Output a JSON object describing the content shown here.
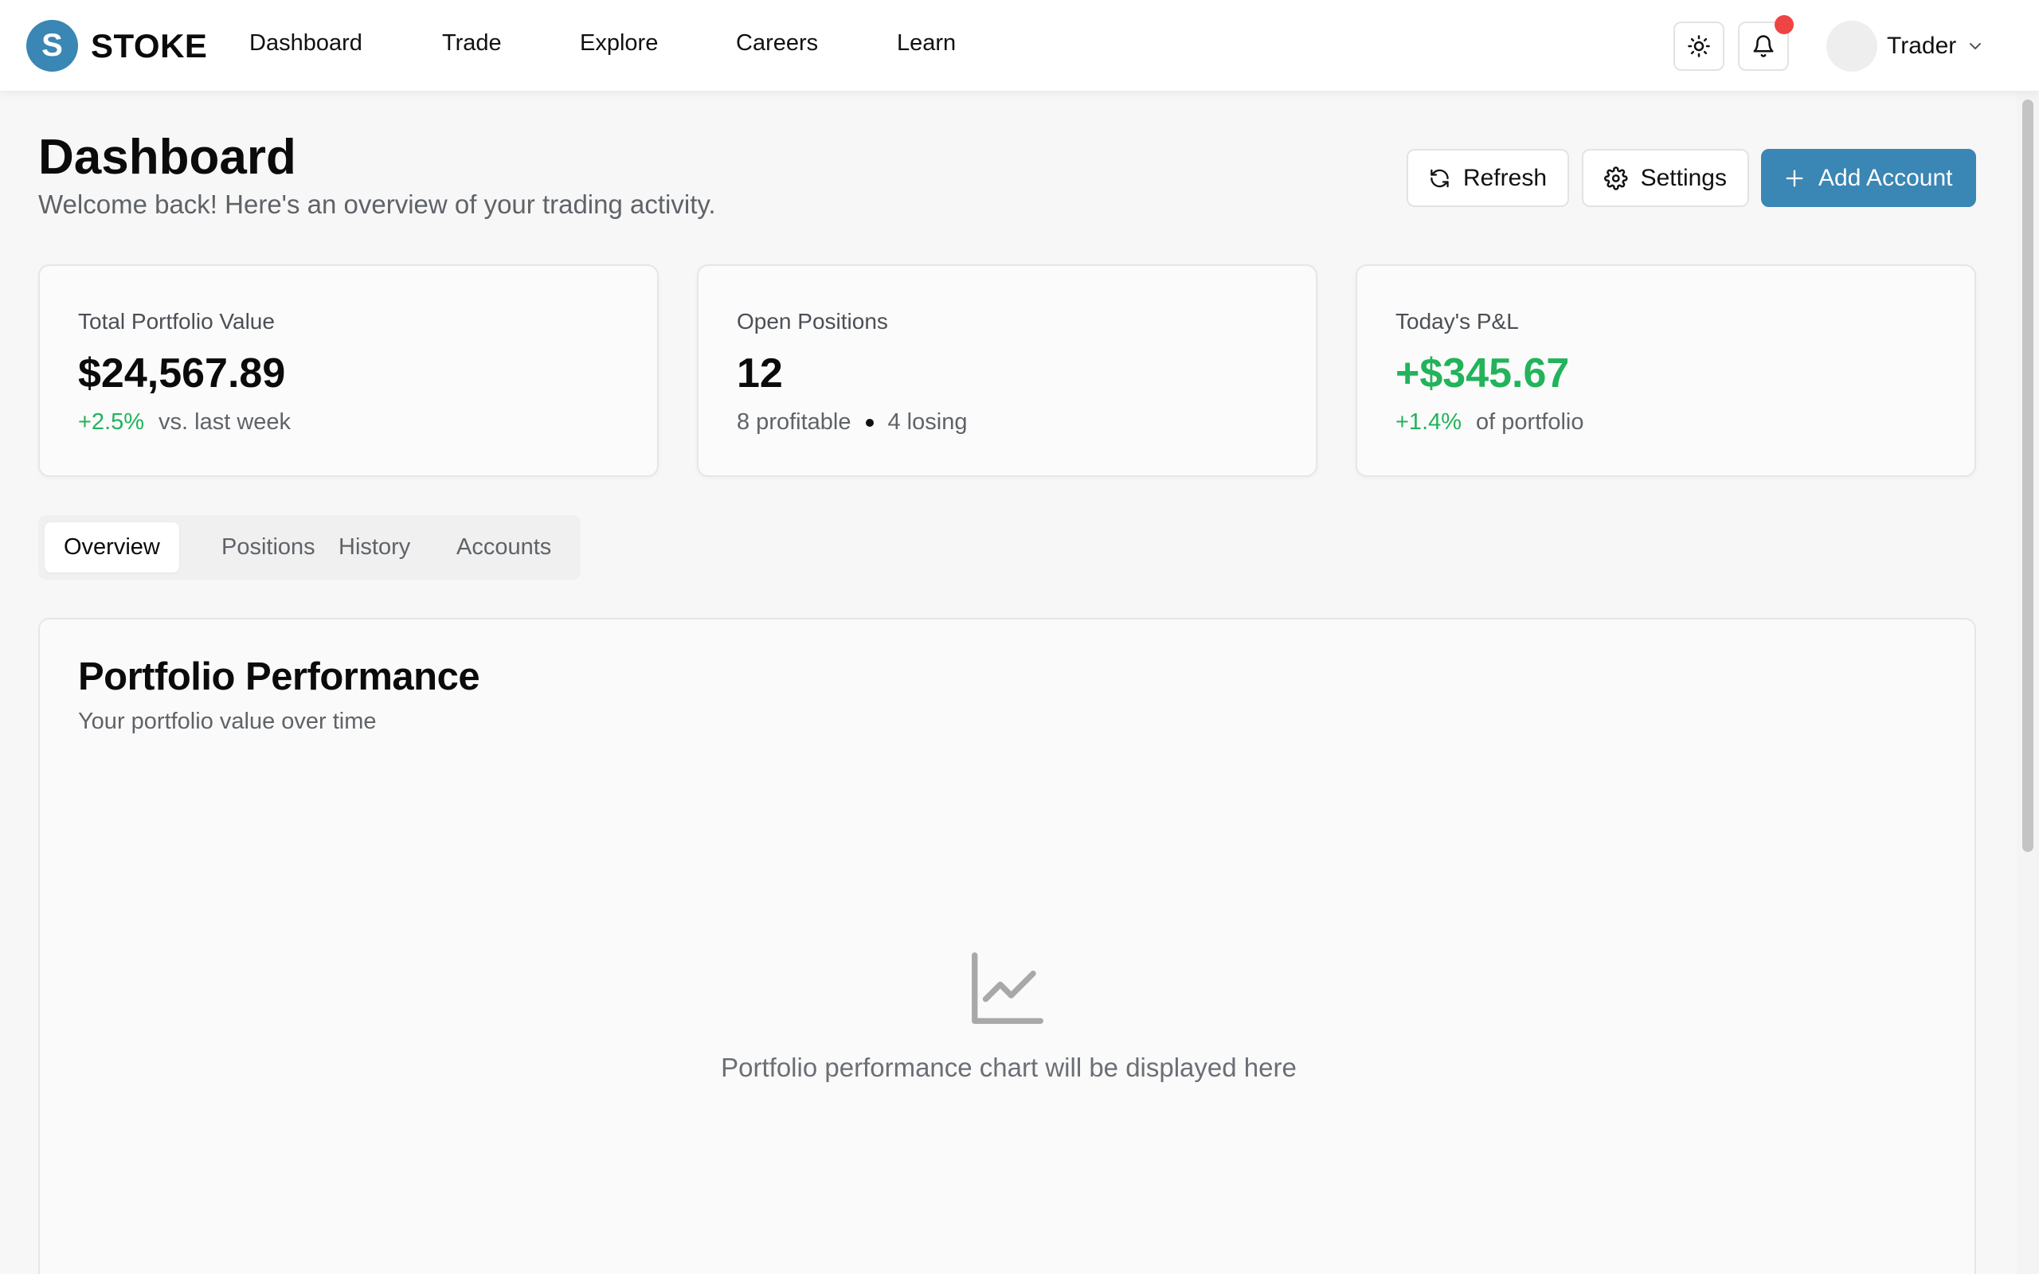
{
  "brand": {
    "logo_letter": "S",
    "name": "STOKE",
    "accent": "#3a86b4"
  },
  "nav": {
    "links": [
      "Dashboard",
      "Trade",
      "Explore",
      "Careers",
      "Learn"
    ],
    "theme_icon": "sun-icon",
    "notification_icon": "bell-icon",
    "notification_dot_color": "#ef4444",
    "user": {
      "name": "Trader",
      "menu_icon": "chevron-down-icon"
    }
  },
  "header": {
    "title": "Dashboard",
    "subtitle": "Welcome back! Here's an overview of your trading activity.",
    "buttons": {
      "refresh": {
        "label": "Refresh",
        "icon": "refresh-icon"
      },
      "settings": {
        "label": "Settings",
        "icon": "gear-icon"
      },
      "add_account": {
        "label": "Add Account",
        "icon": "plus-icon"
      }
    }
  },
  "stats": [
    {
      "label": "Total Portfolio Value",
      "value": "$24,567.89",
      "change": "+2.5%",
      "note": "vs. last week"
    },
    {
      "label": "Open Positions",
      "value": "12",
      "profitable": "8 profitable",
      "losing": "4 losing"
    },
    {
      "label": "Today's P&L",
      "value": "+$345.67",
      "change": "+1.4%",
      "note": "of portfolio"
    }
  ],
  "tabs": {
    "items": [
      "Overview",
      "Positions",
      "History",
      "Accounts"
    ],
    "active": "Overview"
  },
  "performance": {
    "title": "Portfolio Performance",
    "subtitle": "Your portfolio value over time",
    "placeholder_icon": "line-chart-icon",
    "placeholder_text": "Portfolio performance chart will be displayed here"
  },
  "colors": {
    "positive": "#22b35b",
    "primary_button": "#3a86b4"
  }
}
